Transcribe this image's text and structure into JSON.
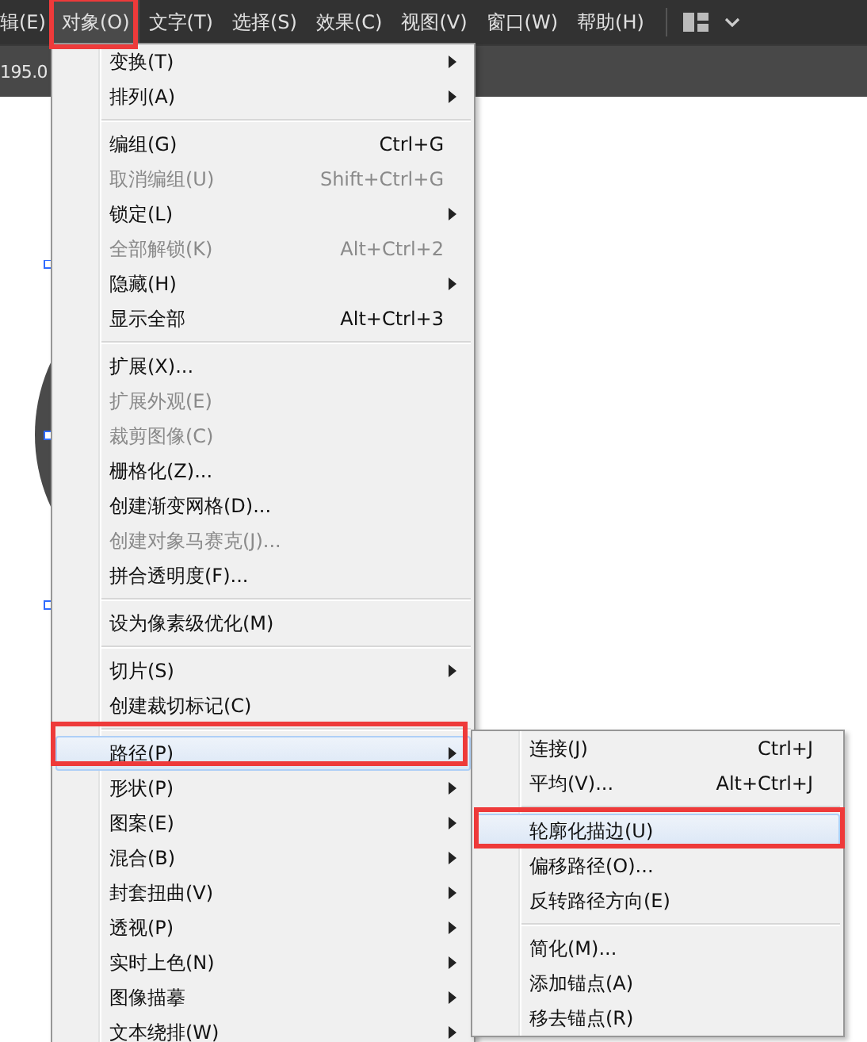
{
  "menubar": [
    {
      "label": "辑(E)",
      "selected": false
    },
    {
      "label": "对象(O)",
      "selected": true
    },
    {
      "label": "文字(T)",
      "selected": false
    },
    {
      "label": "选择(S)",
      "selected": false
    },
    {
      "label": "效果(C)",
      "selected": false
    },
    {
      "label": "视图(V)",
      "selected": false
    },
    {
      "label": "窗口(W)",
      "selected": false
    },
    {
      "label": "帮助(H)",
      "selected": false
    }
  ],
  "control_bar": {
    "value": "195.0"
  },
  "menu": {
    "sections": [
      [
        {
          "label": "变换(T)",
          "submenu": true,
          "disabled": false,
          "selected": false
        },
        {
          "label": "排列(A)",
          "submenu": true,
          "disabled": false,
          "selected": false
        }
      ],
      [
        {
          "label": "编组(G)",
          "shortcut": "Ctrl+G",
          "submenu": false,
          "disabled": false,
          "selected": false
        },
        {
          "label": "取消编组(U)",
          "shortcut": "Shift+Ctrl+G",
          "submenu": false,
          "disabled": true,
          "selected": false
        },
        {
          "label": "锁定(L)",
          "submenu": true,
          "disabled": false,
          "selected": false
        },
        {
          "label": "全部解锁(K)",
          "shortcut": "Alt+Ctrl+2",
          "submenu": false,
          "disabled": true,
          "selected": false
        },
        {
          "label": "隐藏(H)",
          "submenu": true,
          "disabled": false,
          "selected": false
        },
        {
          "label": "显示全部",
          "shortcut": "Alt+Ctrl+3",
          "submenu": false,
          "disabled": false,
          "selected": false
        }
      ],
      [
        {
          "label": "扩展(X)...",
          "submenu": false,
          "disabled": false,
          "selected": false
        },
        {
          "label": "扩展外观(E)",
          "submenu": false,
          "disabled": true,
          "selected": false
        },
        {
          "label": "裁剪图像(C)",
          "submenu": false,
          "disabled": true,
          "selected": false
        },
        {
          "label": "栅格化(Z)...",
          "submenu": false,
          "disabled": false,
          "selected": false
        },
        {
          "label": "创建渐变网格(D)...",
          "submenu": false,
          "disabled": false,
          "selected": false
        },
        {
          "label": "创建对象马赛克(J)...",
          "submenu": false,
          "disabled": true,
          "selected": false
        },
        {
          "label": "拼合透明度(F)...",
          "submenu": false,
          "disabled": false,
          "selected": false
        }
      ],
      [
        {
          "label": "设为像素级优化(M)",
          "submenu": false,
          "disabled": false,
          "selected": false
        }
      ],
      [
        {
          "label": "切片(S)",
          "submenu": true,
          "disabled": false,
          "selected": false
        },
        {
          "label": "创建裁切标记(C)",
          "submenu": false,
          "disabled": false,
          "selected": false
        }
      ],
      [
        {
          "label": "路径(P)",
          "submenu": true,
          "disabled": false,
          "selected": true
        },
        {
          "label": "形状(P)",
          "submenu": true,
          "disabled": false,
          "selected": false
        },
        {
          "label": "图案(E)",
          "submenu": true,
          "disabled": false,
          "selected": false
        },
        {
          "label": "混合(B)",
          "submenu": true,
          "disabled": false,
          "selected": false
        },
        {
          "label": "封套扭曲(V)",
          "submenu": true,
          "disabled": false,
          "selected": false
        },
        {
          "label": "透视(P)",
          "submenu": true,
          "disabled": false,
          "selected": false
        },
        {
          "label": "实时上色(N)",
          "submenu": true,
          "disabled": false,
          "selected": false
        },
        {
          "label": "图像描摹",
          "submenu": true,
          "disabled": false,
          "selected": false
        },
        {
          "label": "文本绕排(W)",
          "submenu": true,
          "disabled": false,
          "selected": false
        }
      ]
    ]
  },
  "submenu": {
    "sections": [
      [
        {
          "label": "连接(J)",
          "shortcut": "Ctrl+J",
          "disabled": false,
          "selected": false
        },
        {
          "label": "平均(V)...",
          "shortcut": "Alt+Ctrl+J",
          "disabled": false,
          "selected": false
        }
      ],
      [
        {
          "label": "轮廓化描边(U)",
          "disabled": false,
          "selected": true
        },
        {
          "label": "偏移路径(O)...",
          "disabled": false,
          "selected": false
        },
        {
          "label": "反转路径方向(E)",
          "disabled": false,
          "selected": false
        }
      ],
      [
        {
          "label": "简化(M)...",
          "disabled": false,
          "selected": false
        },
        {
          "label": "添加锚点(A)",
          "disabled": false,
          "selected": false
        },
        {
          "label": "移去锚点(R)",
          "disabled": false,
          "selected": false
        }
      ]
    ]
  }
}
